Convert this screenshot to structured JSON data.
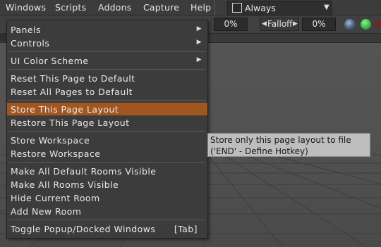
{
  "menubar": {
    "items": [
      "Windows",
      "Scripts",
      "Addons",
      "Capture",
      "Help"
    ],
    "always": {
      "label": "Always",
      "checked": false
    }
  },
  "toolbar": {
    "field1": "0%",
    "falloff_label": "Falloff",
    "field2": "0%"
  },
  "windows_menu": {
    "items": [
      {
        "label": "Panels",
        "submenu": true
      },
      {
        "label": "Controls",
        "submenu": true
      },
      {
        "label": "UI Color Scheme",
        "submenu": true
      },
      {
        "label": "Reset This Page to Default"
      },
      {
        "label": "Reset All Pages to Default"
      },
      {
        "label": "Store This Page Layout",
        "highlighted": true
      },
      {
        "label": "Restore This Page Layout"
      },
      {
        "label": "Store Workspace"
      },
      {
        "label": "Restore Workspace"
      },
      {
        "label": "Make All Default Rooms Visible"
      },
      {
        "label": "Make All Rooms Visible"
      },
      {
        "label": "Hide Current Room"
      },
      {
        "label": "Add New Room"
      },
      {
        "label": "Toggle Popup/Docked Windows",
        "shortcut": "[Tab]"
      }
    ]
  },
  "tooltip": {
    "line1": "Store only this page layout to file",
    "line2": "('END' - Define Hotkey)"
  },
  "colors": {
    "highlight": "#a0561e",
    "menu_bg": "#3c3c3c",
    "tooltip_bg": "#bdbdbd"
  }
}
